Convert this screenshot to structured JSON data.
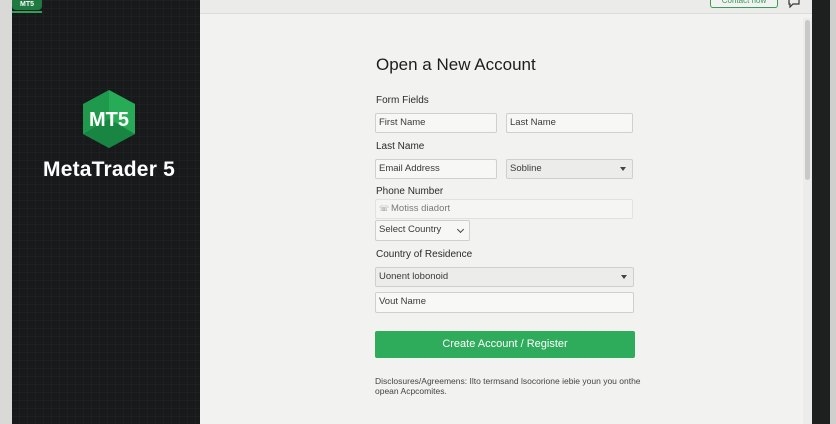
{
  "colors": {
    "accent": "#2eac5c",
    "sidebar_bg": "#17191a",
    "main_bg": "#f2f2f1"
  },
  "sidebar": {
    "mini_logo": "MT5",
    "logo_text": "MT5",
    "brand_name": "MetaTrader 5"
  },
  "topbar": {
    "contact_label": "Contact now",
    "chat_icon": "chat-bubble-icon"
  },
  "form": {
    "title": "Open a New Account",
    "form_fields_label": "Form Fields",
    "first_name_placeholder": "First Name",
    "last_name_placeholder": "Last Name",
    "last_name_label": "Last Name",
    "email_placeholder": "Email Address",
    "subline_select": "Sobline",
    "phone_label": "Phone Number",
    "phone_placeholder": "Motiss diadort",
    "country_select": "Select Country",
    "residence_label": "Country of Residence",
    "residence_select": "Uonent lobonoid",
    "your_name_placeholder": "Vout Name",
    "submit_label": "Create Account / Register",
    "disclosure": "Disclosures/Agreemens: Ilto termsand lsocorione iebie youn you onthe opean Acpcomites."
  }
}
